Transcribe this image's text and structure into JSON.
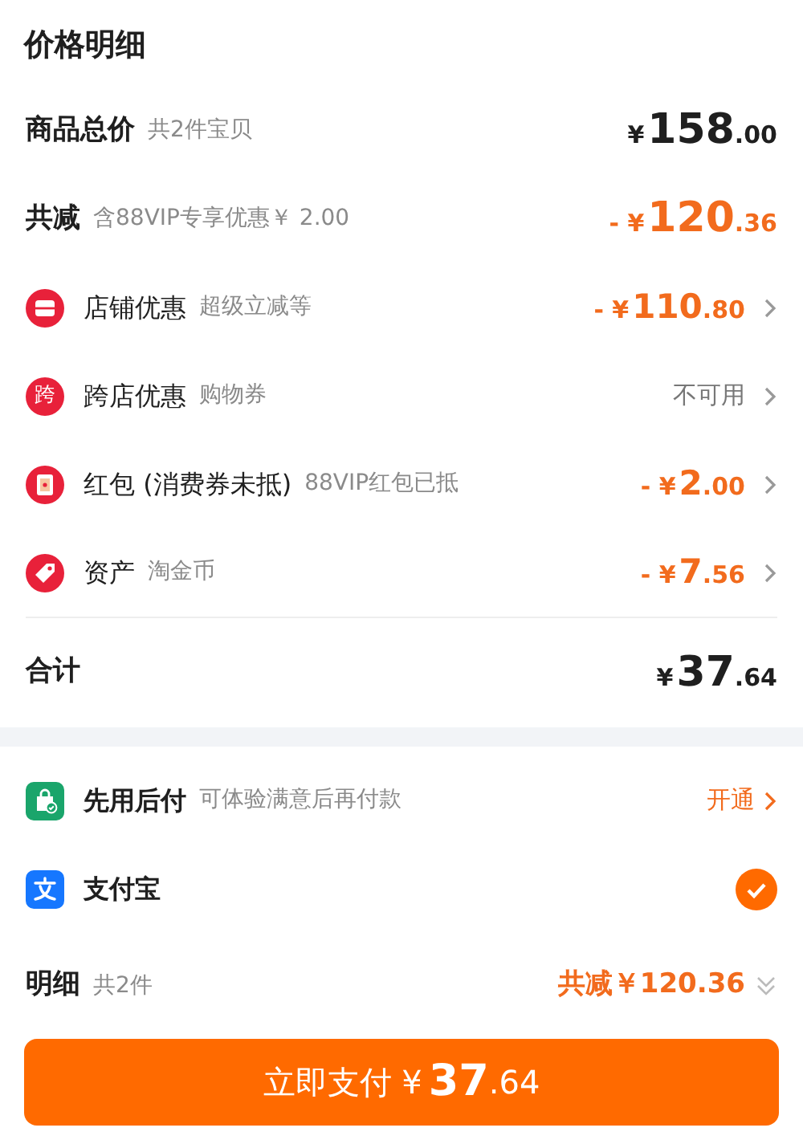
{
  "title": "价格明细",
  "summary": [
    {
      "label": "商品总价",
      "note": "共2件宝贝",
      "amount": {
        "currency": "¥",
        "whole": "158",
        "fraction": ".00"
      }
    },
    {
      "label": "共减",
      "note": "含88VIP专享优惠￥ 2.00",
      "amount": {
        "sign": "-",
        "currency": "¥",
        "whole": "120",
        "fraction": ".36"
      }
    }
  ],
  "discounts": [
    {
      "kind": "shop",
      "label": "店铺优惠",
      "note": "超级立减等",
      "amount": {
        "sign": "-",
        "currency": "¥",
        "whole": "110",
        "fraction": ".80"
      }
    },
    {
      "kind": "char",
      "icon_text": "跨",
      "label": "跨店优惠",
      "note": "购物券",
      "status": "不可用"
    },
    {
      "kind": "packet",
      "label": "红包 (消费券未抵)",
      "note": "88VIP红包已抵",
      "amount": {
        "sign": "-",
        "currency": "¥",
        "whole": "2",
        "fraction": ".00"
      }
    },
    {
      "kind": "tag",
      "label": "资产",
      "note": "淘金币",
      "amount": {
        "sign": "-",
        "currency": "¥",
        "whole": "7",
        "fraction": ".56"
      }
    }
  ],
  "total": {
    "label": "合计",
    "amount": {
      "currency": "¥",
      "whole": "37",
      "fraction": ".64"
    }
  },
  "payment_methods": [
    {
      "kind": "bag",
      "label": "先用后付",
      "note": "可体验满意后再付款",
      "action": "开通",
      "selected": false
    },
    {
      "kind": "wallet",
      "label": "支付宝",
      "selected": true
    }
  ],
  "details": {
    "label": "明细",
    "note": "共2件",
    "saving": "共减￥120.36"
  },
  "pay_button": {
    "label": "立即支付",
    "amount": {
      "currency": "¥",
      "whole": "37",
      "fraction": ".64"
    }
  }
}
